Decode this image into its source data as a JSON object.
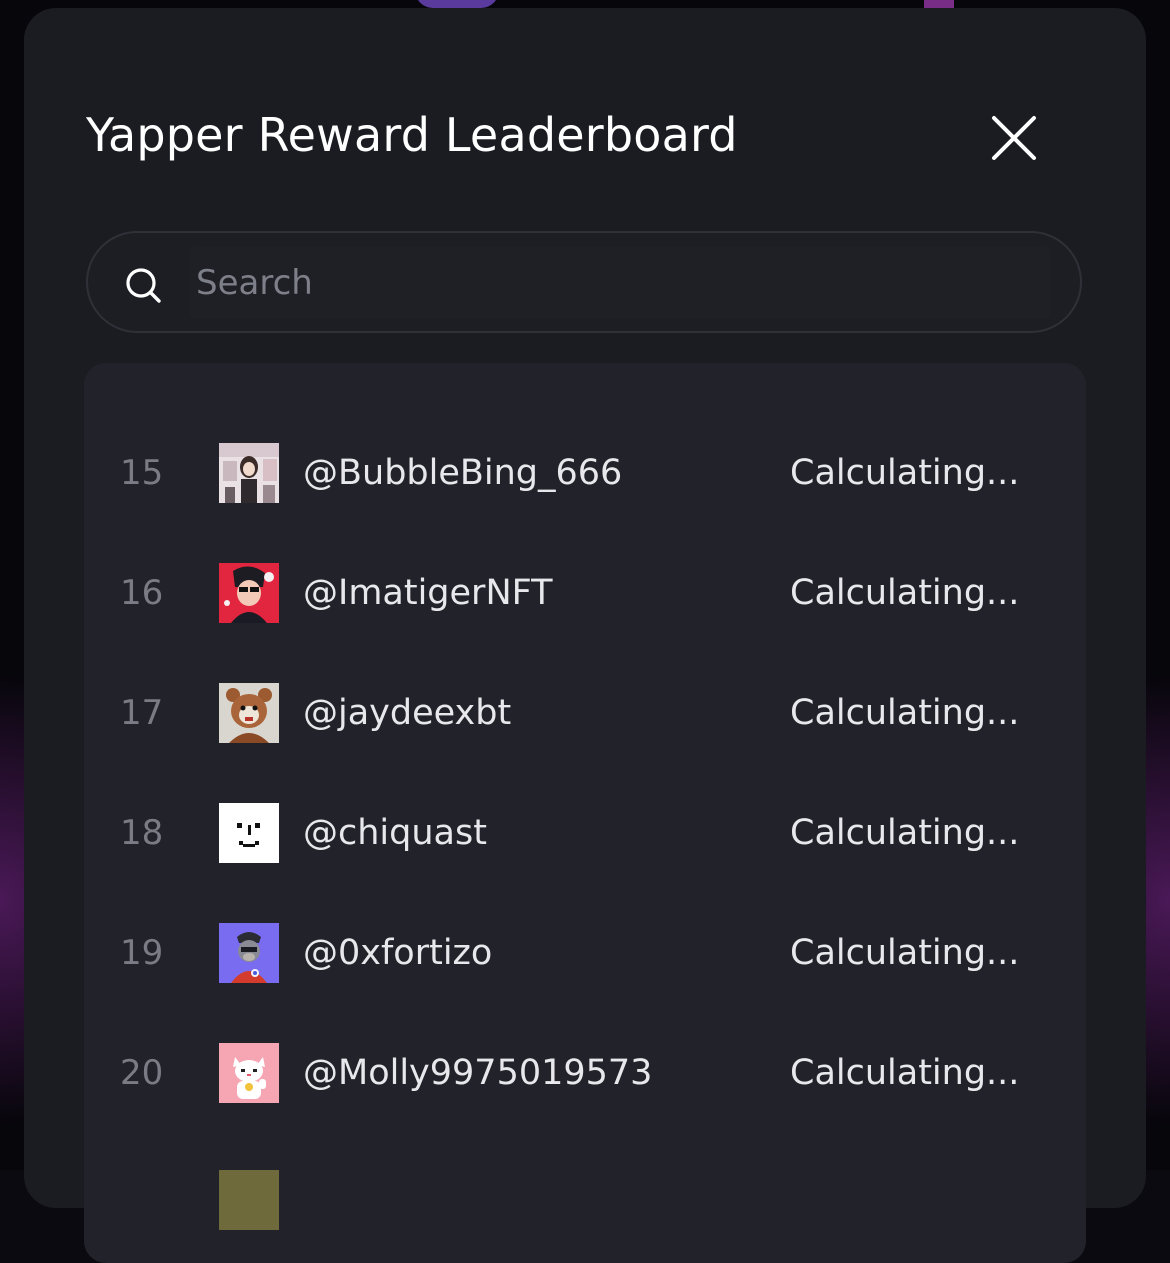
{
  "modal": {
    "title": "Yapper Reward Leaderboard",
    "close_icon": "close-icon"
  },
  "search": {
    "placeholder": "Search",
    "value": "",
    "icon": "search-icon"
  },
  "leaderboard": {
    "rows": [
      {
        "rank": "15",
        "handle": "@BubbleBing_666",
        "reward": "Calculating...",
        "avatar": "photo-avatar"
      },
      {
        "rank": "16",
        "handle": "@ImatigerNFT",
        "reward": "Calculating...",
        "avatar": "anime-avatar"
      },
      {
        "rank": "17",
        "handle": "@jaydeexbt",
        "reward": "Calculating...",
        "avatar": "bear-avatar"
      },
      {
        "rank": "18",
        "handle": "@chiquast",
        "reward": "Calculating...",
        "avatar": "pixel-face-avatar"
      },
      {
        "rank": "19",
        "handle": "@0xfortizo",
        "reward": "Calculating...",
        "avatar": "ape-avatar"
      },
      {
        "rank": "20",
        "handle": "@Molly9975019573",
        "reward": "Calculating...",
        "avatar": "lucky-cat-avatar"
      }
    ]
  },
  "colors": {
    "modal_bg": "#1b1c22",
    "list_bg": "#22232a",
    "text_primary": "#e8e8ec",
    "text_rank": "#7a7b84",
    "placeholder": "#7d7f89",
    "backdrop_accent": "#7a2d86"
  }
}
